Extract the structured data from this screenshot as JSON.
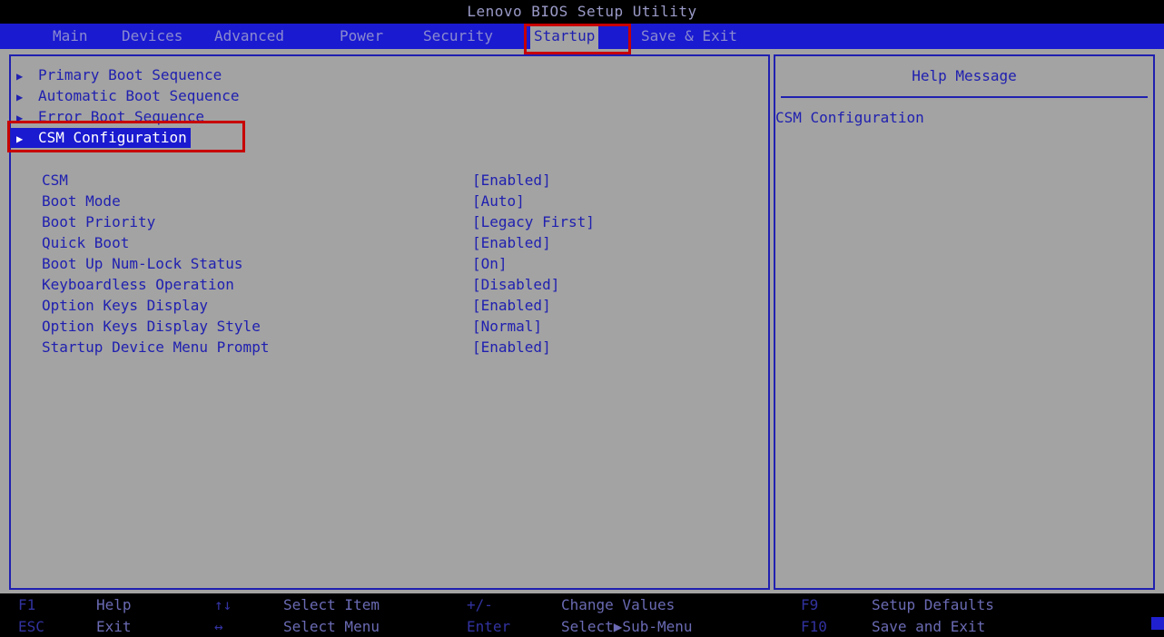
{
  "title": "Lenovo BIOS Setup Utility",
  "menu": {
    "tabs": [
      {
        "label": "Main"
      },
      {
        "label": "Devices"
      },
      {
        "label": "Advanced"
      },
      {
        "label": "Power"
      },
      {
        "label": "Security"
      },
      {
        "label": "Startup"
      },
      {
        "label": "Save & Exit"
      }
    ],
    "active_tab": "Startup"
  },
  "submenus": [
    {
      "label": "Primary Boot Sequence",
      "arrow": "▶"
    },
    {
      "label": "Automatic Boot Sequence",
      "arrow": "▶"
    },
    {
      "label": "Error Boot Sequence",
      "arrow": "▶"
    },
    {
      "label": "CSM Configuration",
      "arrow": "▶"
    }
  ],
  "selected_submenu": "CSM Configuration",
  "settings": [
    {
      "label": "CSM",
      "value": "[Enabled]"
    },
    {
      "label": "Boot Mode",
      "value": "[Auto]"
    },
    {
      "label": "Boot Priority",
      "value": "[Legacy First]"
    },
    {
      "label": "Quick Boot",
      "value": "[Enabled]"
    },
    {
      "label": "Boot Up Num-Lock Status",
      "value": "[On]"
    },
    {
      "label": "Keyboardless Operation",
      "value": "[Disabled]"
    },
    {
      "label": "Option Keys Display",
      "value": "[Enabled]"
    },
    {
      "label": "Option Keys Display Style",
      "value": "[Normal]"
    },
    {
      "label": "Startup Device Menu Prompt",
      "value": "[Enabled]"
    }
  ],
  "help": {
    "title": "Help Message",
    "text": "CSM Configuration"
  },
  "footer": {
    "row1": [
      {
        "key": "F1",
        "desc": "Help"
      },
      {
        "key": "↑↓",
        "desc": "Select Item"
      },
      {
        "key": "+/-",
        "desc": "Change Values"
      },
      {
        "key": "F9",
        "desc": "Setup Defaults"
      }
    ],
    "row2": [
      {
        "key": "ESC",
        "desc": "Exit"
      },
      {
        "key": "↔",
        "desc": "Select Menu"
      },
      {
        "key": "Enter",
        "desc": "Select▶Sub-Menu"
      },
      {
        "key": "F10",
        "desc": "Save and Exit"
      }
    ]
  },
  "colors": {
    "menu_bar": "#1a1ad0",
    "panel_bg": "#a3a3a3",
    "text_blue": "#2020b0",
    "annotation_red": "#c80000"
  }
}
